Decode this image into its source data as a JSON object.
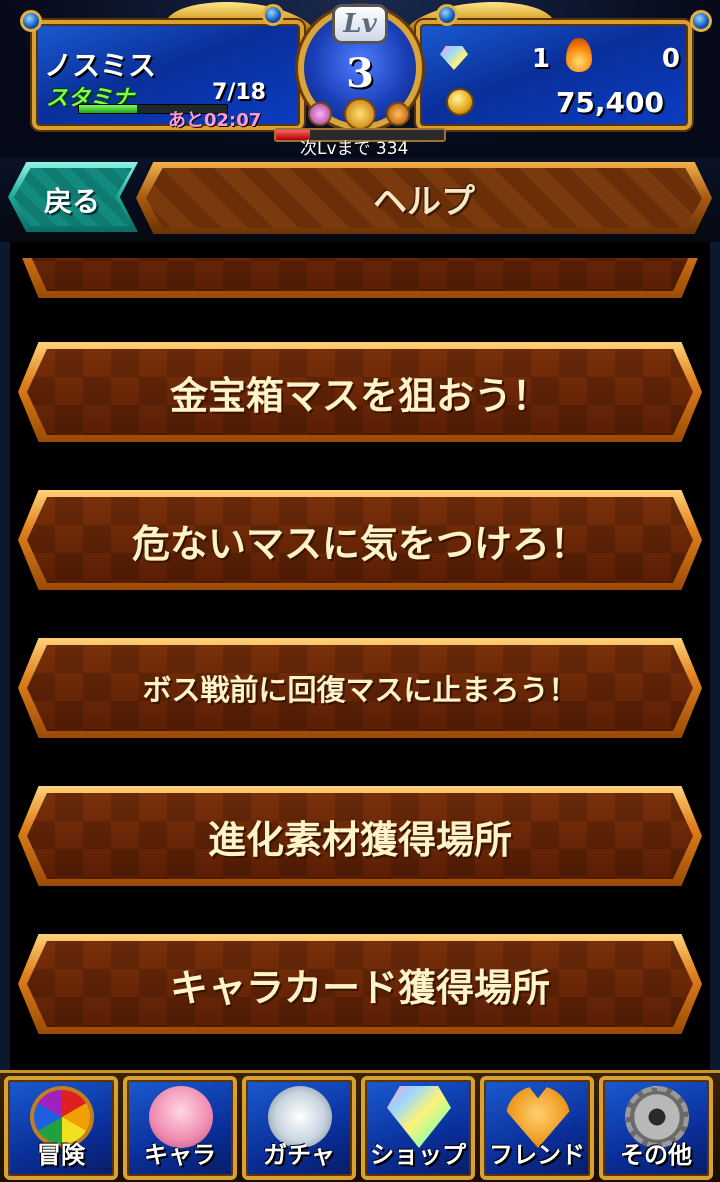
{
  "player": {
    "name": "ノスミス",
    "stamina_label": "スタミナ",
    "stamina_value": "7/18",
    "stamina_fraction": 0.39,
    "stamina_timer": "あと02:07"
  },
  "level": {
    "badge": "Lv",
    "value": "3",
    "next_label": "次Lvまで 334",
    "exp_fraction": 0.2
  },
  "currency": {
    "gem_count": "1",
    "flame_count": "0",
    "coin_count": "75,400"
  },
  "titlebar": {
    "back_label": "戻る",
    "title": "ヘルプ"
  },
  "help_items": [
    {
      "label": ""
    },
    {
      "label": "金宝箱マスを狙おう！"
    },
    {
      "label": "危ないマスに気をつけろ！"
    },
    {
      "label": "ボス戦前に回復マスに止まろう！"
    },
    {
      "label": "進化素材獲得場所"
    },
    {
      "label": "キャラカード獲得場所"
    }
  ],
  "bottom_nav": [
    {
      "label": "冒険",
      "icon": "wheel-icon"
    },
    {
      "label": "キャラ",
      "icon": "character-icon"
    },
    {
      "label": "ガチャ",
      "icon": "keyhole-crown-icon"
    },
    {
      "label": "ショップ",
      "icon": "diamond-icon"
    },
    {
      "label": "フレンド",
      "icon": "handshake-icon"
    },
    {
      "label": "その他",
      "icon": "gear-icon"
    }
  ],
  "colors": {
    "panel_blue": "#0a2f9a",
    "gold_border": "#d8a133",
    "button_brown": "#7a300a",
    "stamina_green": "#7dff4a",
    "back_teal": "#1ea898"
  }
}
